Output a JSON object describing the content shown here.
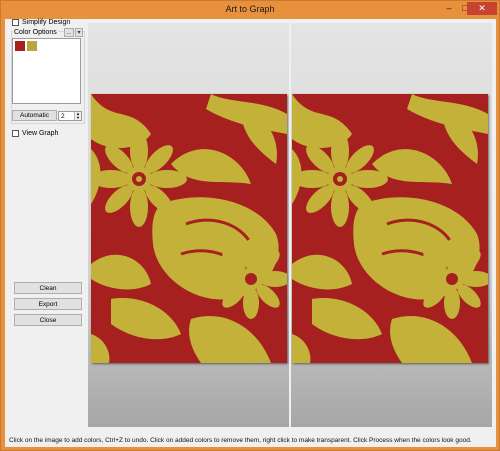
{
  "window": {
    "title": "Art to Graph",
    "min_glyph": "–",
    "max_glyph": "□",
    "close_glyph": "✕"
  },
  "sidebar": {
    "simplify_design_label": "Simplify Design",
    "color_options_label": "Color Options",
    "ellipsis_label": "...",
    "dropdown_glyph": "▾",
    "colors": [
      "#a62020",
      "#b9a53c"
    ],
    "automatic_label": "Automatic",
    "automatic_count": "2",
    "spin_up": "▲",
    "spin_down": "▼",
    "view_graph_label": "View Graph",
    "clean_label": "Clean",
    "export_label": "Export",
    "close_label": "Close"
  },
  "pattern": {
    "background_color": "#a62020",
    "foreground_color": "#c3b13a"
  },
  "status": {
    "text": "Click on the image to add colors, Ctrl+Z to undo. Click on added colors to remove them, right click to make transparent. Click Process when the colors look good."
  }
}
